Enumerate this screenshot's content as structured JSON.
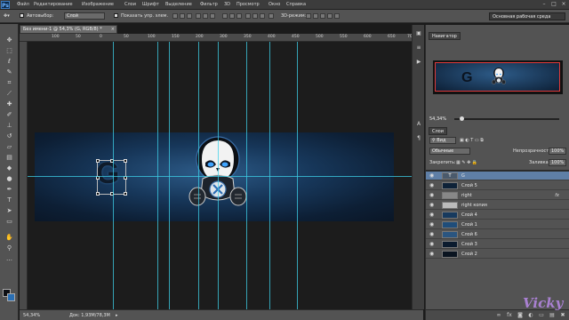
{
  "menubar": {
    "app_icon": "Ps",
    "items": [
      "Файл",
      "Редактирование",
      "Изображение",
      "Слои",
      "Шрифт",
      "Выделение",
      "Фильтр",
      "3D",
      "Просмотр",
      "Окно",
      "Справка"
    ],
    "window_controls": [
      "minimize-icon",
      "maximize-icon",
      "close-icon"
    ]
  },
  "options": {
    "autoselect_label": "Автовыбор:",
    "autoselect_value": "Слой",
    "show_controls_label": "Показать упр. элем.",
    "mode_3d_label": "3D-режим:",
    "workspace": "Основная рабочая среда"
  },
  "document": {
    "tab_title": "Без имени-1 @ 54,3% (G, RGB/8) *",
    "letter": "G"
  },
  "ruler": {
    "top": [
      "100",
      "50",
      "0",
      "50",
      "100",
      "150",
      "200",
      "300",
      "350",
      "400",
      "450",
      "500",
      "550",
      "600",
      "650",
      "700",
      "750"
    ]
  },
  "status": {
    "zoom": "54,34%",
    "doc_info": "Док: 1,93М/78,3М"
  },
  "navigator": {
    "tab_label": "Навигатор",
    "zoom": "54,34%",
    "letter": "G"
  },
  "layers": {
    "tab_label": "Слои",
    "filter_label": "Вид",
    "blend_mode": "Обычные",
    "opacity_label": "Непрозрачность:",
    "opacity": "100%",
    "lock_label": "Закрепить:",
    "fill_label": "Заливка:",
    "fill": "100%",
    "items": [
      {
        "name": "G"
      },
      {
        "name": "Слой 5"
      },
      {
        "name": "right",
        "fx": "fx"
      },
      {
        "name": "right копия"
      },
      {
        "name": "Слой 4"
      },
      {
        "name": "Слой 1"
      },
      {
        "name": "Слой 6"
      },
      {
        "name": "Слой 3"
      },
      {
        "name": "Слой 2"
      }
    ]
  },
  "watermark": "Vicky",
  "colors": {
    "guide": "#3ed0e8",
    "banner_blue": "#2d5b88",
    "foreground": "#0d0f14",
    "background": "#2a6fb4",
    "nav_frame": "#e03a3a"
  }
}
